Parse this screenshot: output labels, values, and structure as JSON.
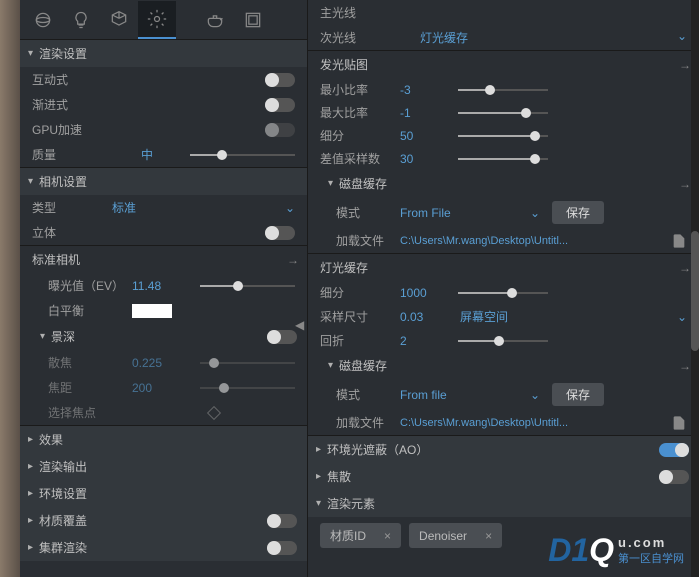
{
  "toolbar_icons": [
    "sphere",
    "bulb",
    "cube",
    "gear",
    "teapot",
    "window"
  ],
  "left": {
    "render_settings": "渲染设置",
    "interactive": "互动式",
    "progressive": "渐进式",
    "gpu_accel": "GPU加速",
    "quality": "质量",
    "quality_val": "中",
    "camera_settings": "相机设置",
    "type": "类型",
    "type_val": "标准",
    "stereo": "立体",
    "standard_camera": "标准相机",
    "ev": "曝光值（EV）",
    "ev_val": "11.48",
    "wb": "白平衡",
    "dof": "景深",
    "defocus": "散焦",
    "defocus_val": "0.225",
    "focal": "焦距",
    "focal_val": "200",
    "pick_focus": "选择焦点",
    "effects": "效果",
    "render_output": "渲染输出",
    "env_settings": "环境设置",
    "mat_override": "材质覆盖",
    "swarm_render": "集群渲染"
  },
  "right": {
    "main_ray": "主光线",
    "secondary": "次光线",
    "secondary_val": "灯光缓存",
    "emissive": "发光贴图",
    "min_rate": "最小比率",
    "min_rate_val": "-3",
    "max_rate": "最大比率",
    "max_rate_val": "-1",
    "subdiv": "细分",
    "subdiv_val": "50",
    "diff_samples": "差值采样数",
    "diff_samples_val": "30",
    "disk_cache": "磁盘缓存",
    "mode": "模式",
    "mode_val": "From File",
    "save": "保存",
    "load_file": "加载文件",
    "filepath": "C:\\Users\\Mr.wang\\Desktop\\Untitl...",
    "light_cache": "灯光缓存",
    "lc_subdiv": "细分",
    "lc_subdiv_val": "1000",
    "sample_size": "采样尺寸",
    "sample_size_val": "0.03",
    "sample_space": "屏幕空间",
    "retrace": "回折",
    "retrace_val": "2",
    "mode2_val": "From file",
    "ao": "环境光遮蔽（AO）",
    "caustics": "焦散",
    "render_elements": "渲染元素",
    "tag_material_id": "材质ID",
    "tag_denoiser": "Denoiser"
  },
  "watermark": {
    "logo": "D1",
    "q": "Q",
    "site": "u.com",
    "sub": "第一区自学网"
  }
}
